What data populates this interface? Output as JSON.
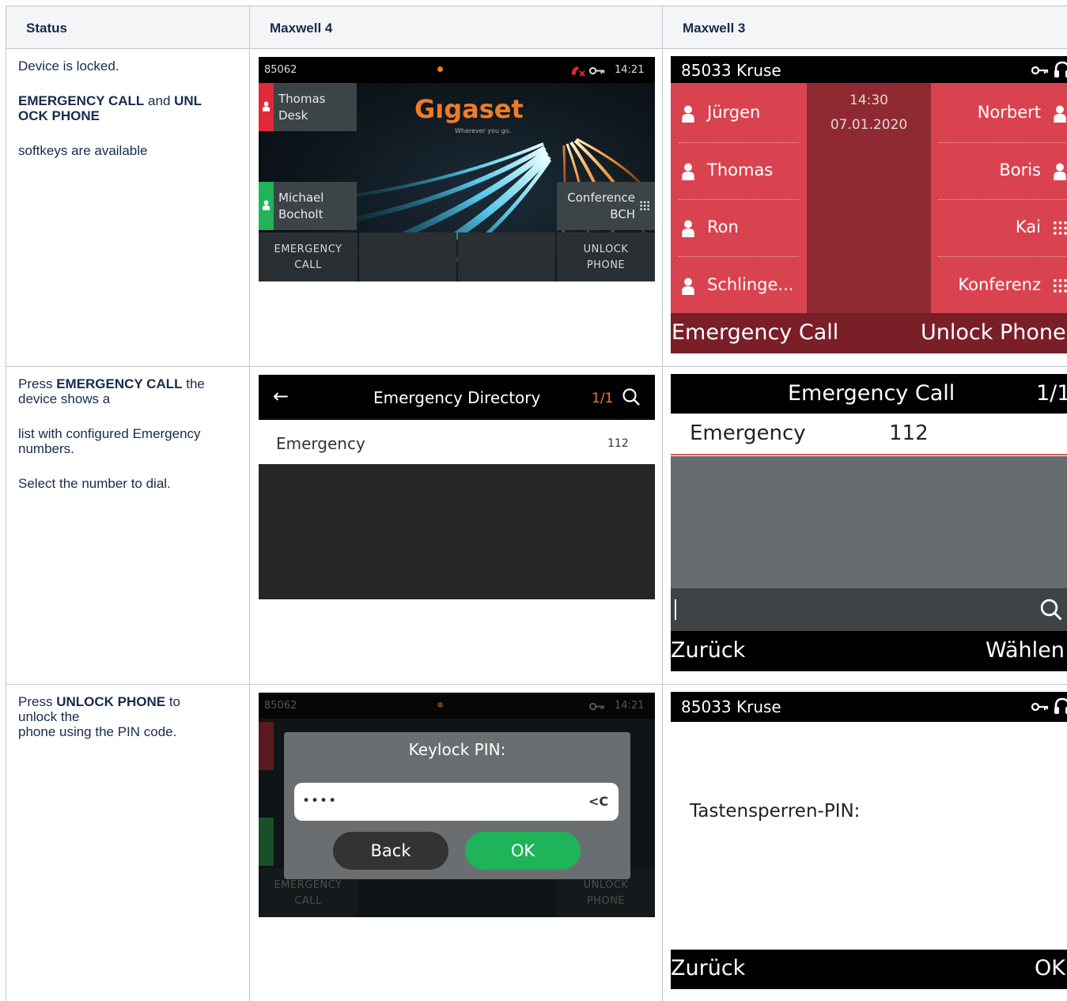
{
  "table": {
    "headers": [
      "Status",
      "Maxwell 4",
      "Maxwell 3"
    ],
    "row1": {
      "line1": "Device is locked.",
      "b1": "EMERGENCY CALL",
      "and": " and ",
      "b2a": "UNL",
      "b2b": "OCK PHONE",
      "line3": "softkeys are available"
    },
    "row2": {
      "pre": "Press ",
      "b": "EMERGENCY CALL",
      "post": " the",
      "line1b": "device shows a",
      "line2a": "list with configured Emergency",
      "line2b": "numbers.",
      "line3": "Select the number to dial."
    },
    "row3": {
      "pre": "Press ",
      "b": "UNLOCK PHONE",
      "post": " to",
      "line1b": "unlock the",
      "line2": "phone using the PIN code."
    }
  },
  "m4_locked": {
    "number": "85062",
    "time": "14:21",
    "brand": "Gıgaset",
    "tagline": "Wherever you go.",
    "tile1": [
      "Thomas",
      "Desk"
    ],
    "tile2": [
      "Michael",
      "Bocholt"
    ],
    "tile3": [
      "Conference",
      "BCH"
    ],
    "sk_left": [
      "EMERGENCY",
      "CALL"
    ],
    "sk_right": [
      "UNLOCK",
      "PHONE"
    ],
    "colors": {
      "busy": "#e02a36",
      "free": "#1fb35a",
      "brand": "#f07a28"
    }
  },
  "m3_locked": {
    "title": "85033 Kruse",
    "time": "14:30",
    "date": "07.01.2020",
    "left": [
      "Jürgen",
      "Thomas",
      "Ron",
      "Schlinge..."
    ],
    "right": [
      "Norbert",
      "Boris",
      "Kai",
      "Konferenz"
    ],
    "sk_left": "Emergency Call",
    "sk_right": "Unlock Phone"
  },
  "m4_dir": {
    "title": "Emergency Directory",
    "page": "1/1",
    "entry": "Emergency",
    "number": "112"
  },
  "m3_dir": {
    "title": "Emergency Call",
    "page": "1/1",
    "entry": "Emergency",
    "number": "112",
    "sk_left": "Zurück",
    "sk_right": "Wählen"
  },
  "m4_pin": {
    "title": "Keylock PIN:",
    "value": "••••",
    "clear": "<C",
    "back": "Back",
    "ok": "OK"
  },
  "m3_pin": {
    "title": "85033 Kruse",
    "label": "Tastensperren-PIN:",
    "sk_left": "Zurück",
    "sk_right": "OK"
  }
}
